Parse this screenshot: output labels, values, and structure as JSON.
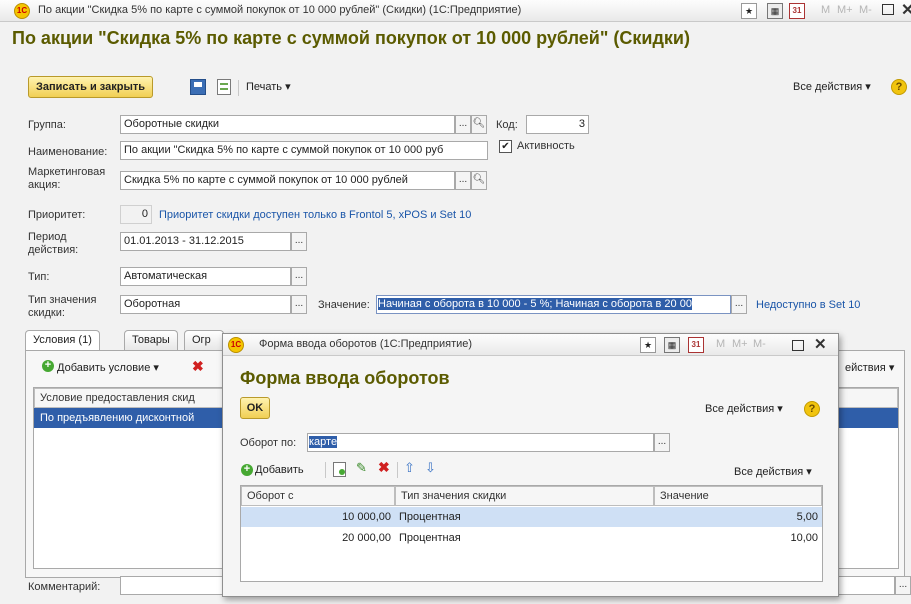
{
  "window": {
    "title": "По акции \"Скидка 5% по  карте с суммой покупок от 10 000 рублей\" (Скидки)  (1С:Предприятие)",
    "logo_text": "1С"
  },
  "form": {
    "heading": "По акции \"Скидка 5% по  карте с суммой покупок от 10 000 рублей\" (Скидки)",
    "toolbar": {
      "save_close": "Записать и закрыть",
      "print": "Печать",
      "all_actions": "Все действия"
    },
    "fields": {
      "group_label": "Группа:",
      "group_value": "Оборотные скидки",
      "code_label": "Код:",
      "code_value": "3",
      "name_label": "Наименование:",
      "name_value": "По акции \"Скидка 5% по  карте с суммой покупок от 10 000 руб",
      "active_label": "Активность",
      "promo_label": "Маркетинговая акция:",
      "promo_value": "Скидка 5% по  карте с суммой покупок от 10 000 рублей",
      "priority_label": "Приоритет:",
      "priority_value": "0",
      "priority_note": "Приоритет скидки доступен только в Frontol 5, xPOS и Set 10",
      "period_label": "Период действия:",
      "period_value": "01.01.2013 - 31.12.2015",
      "type_label": "Тип:",
      "type_value": "Автоматическая",
      "value_type_label": "Тип значения скидки:",
      "value_type_value": "Оборотная",
      "value_label": "Значение:",
      "value_value": "Начиная с оборота в 10 000 - 5 %; Начиная с оборота в 20 00",
      "unavailable_note": "Недоступно в Set 10",
      "comment_label": "Комментарий:"
    },
    "tabs": [
      "Условия (1)",
      "Товары",
      "Огр"
    ],
    "conditions": {
      "add_label": "Добавить условие",
      "all_actions_cut": "ействия",
      "column": "Условие предоставления скид",
      "row": "По предъявлению дисконтной"
    }
  },
  "dialog": {
    "title": "Форма ввода оборотов  (1С:Предприятие)",
    "heading": "Форма ввода оборотов",
    "ok": "OK",
    "all_actions": "Все действия",
    "turnover_label": "Оборот по:",
    "turnover_value": "карте",
    "add_label": "Добавить",
    "table_all_actions": "Все действия",
    "columns": [
      "Оборот с",
      "Тип значения скидки",
      "Значение"
    ],
    "rows": [
      {
        "from": "10 000,00",
        "type": "Процентная",
        "value": "5,00"
      },
      {
        "from": "20 000,00",
        "type": "Процентная",
        "value": "10,00"
      }
    ]
  },
  "title_buttons": [
    "M",
    "M+",
    "M-"
  ]
}
